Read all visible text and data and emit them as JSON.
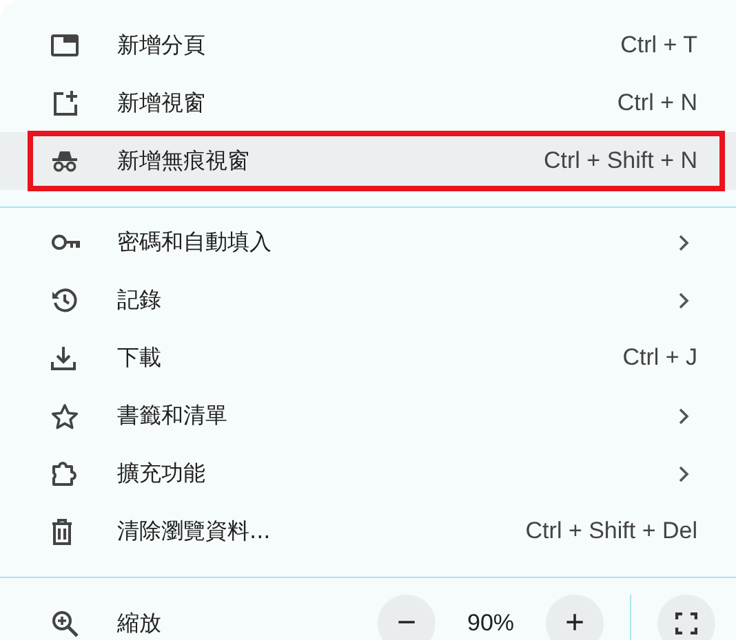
{
  "sections": [
    {
      "items": [
        {
          "label": "新增分頁",
          "shortcut": "Ctrl + T",
          "selected": false
        },
        {
          "label": "新增視窗",
          "shortcut": "Ctrl + N",
          "selected": false
        },
        {
          "label": "新增無痕視窗",
          "shortcut": "Ctrl + Shift + N",
          "selected": true
        }
      ]
    },
    {
      "items": [
        {
          "label": "密碼和自動填入",
          "submenu": true,
          "selected": false
        },
        {
          "label": "記錄",
          "submenu": true,
          "selected": false
        },
        {
          "label": "下載",
          "shortcut": "Ctrl + J",
          "selected": false
        },
        {
          "label": "書籤和清單",
          "submenu": true,
          "selected": false
        },
        {
          "label": "擴充功能",
          "submenu": true,
          "selected": false
        },
        {
          "label": "清除瀏覽資料...",
          "shortcut": "Ctrl + Shift + Del",
          "selected": false
        }
      ]
    }
  ],
  "zoom": {
    "label": "縮放",
    "minus": "−",
    "value": "90%",
    "plus": "+"
  }
}
